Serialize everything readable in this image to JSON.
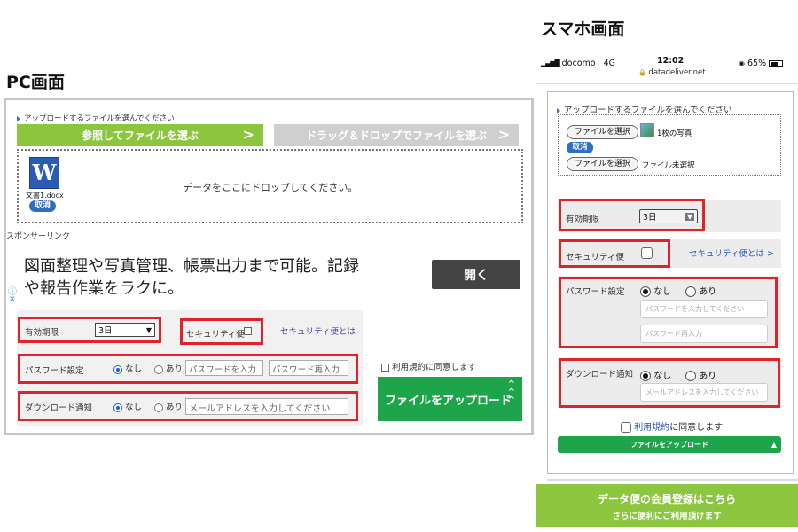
{
  "headings": {
    "pc": "PC画面",
    "mobile": "スマホ画面"
  },
  "pc": {
    "upload_prompt": "アップロードするファイルを選んでください",
    "browse_button": "参照してファイルを選ぶ",
    "drag_button": "ドラッグ＆ドロップでファイルを選ぶ",
    "chevron": ">",
    "file_icon_letter": "W",
    "file_name": "文書1.docx",
    "cancel_label": "取消",
    "drop_message": "データをここにドロップしてください。",
    "sponsored_label": "スポンサーリンク",
    "ad_text_line1": "図面整理や写真管理、帳票出力まで可能。記録",
    "ad_text_line2": "や報告作業をラクに。",
    "ad_button": "開く",
    "ad_info_icon": "ⓘ",
    "ad_close_icon": "✕",
    "expiry_label": "有効期限",
    "expiry_value": "3日",
    "security_label": "セキュリティ便",
    "security_link": "セキュリティ便とは",
    "password_label": "パスワード設定",
    "download_notice_label": "ダウンロード通知",
    "radio_none": "なし",
    "radio_yes": "あり",
    "password_placeholder": "パスワードを入力",
    "password_confirm_placeholder": "パスワード再入力",
    "email_placeholder": "メールアドレスを入力してください",
    "terms_label": "利用規約に同意します",
    "upload_button": "ファイルをアップロード"
  },
  "mobile": {
    "status": {
      "carrier": "docomo",
      "network": "4G",
      "time": "12:02",
      "url": "datadeliver.net",
      "battery": "65%"
    },
    "upload_prompt": "アップロードするファイルを選んでください",
    "choose_file": "ファイルを選択",
    "file1_info": "1枚の写真",
    "cancel_label": "取消",
    "file2_info": "ファイル未選択",
    "expiry_label": "有効期限",
    "expiry_value": "3日",
    "security_label": "セキュリティ便",
    "security_link": "セキュリティ便とは >",
    "password_label": "パスワード設定",
    "radio_none": "なし",
    "radio_yes": "あり",
    "password_placeholder": "パスワードを入力してください",
    "password_confirm_placeholder": "パスワード再入力",
    "download_notice_label": "ダウンロード通知",
    "email_placeholder": "メールアドレスを入力してください",
    "terms_link": "利用規約",
    "terms_rest": "に同意します",
    "upload_button": "ファイルをアップロード",
    "upload_arrow": "▲",
    "banner_line1": "データ便の会員登録はこちら",
    "banner_line2": "さらに便利にご利用頂けます"
  },
  "colors": {
    "highlight_red": "#e0222d",
    "primary_green": "#8cc63f",
    "upload_green": "#1ea54c",
    "gray_button": "#cfcfcf",
    "link_blue": "#2a56c6"
  }
}
